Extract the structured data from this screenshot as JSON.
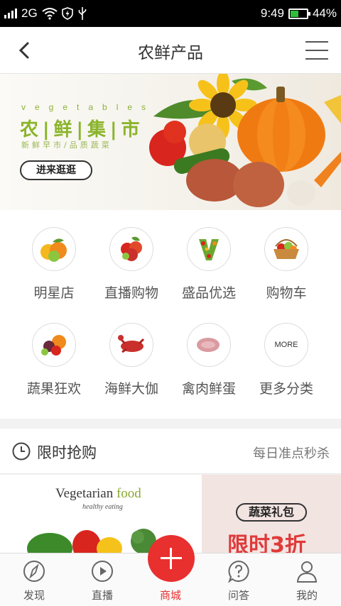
{
  "status_bar": {
    "network": "2G",
    "time": "9:49",
    "battery": "44%",
    "battery_level": 0.44,
    "icons": [
      "signal-icon",
      "wifi-icon",
      "shield-icon",
      "usb-icon",
      "battery-icon"
    ]
  },
  "header": {
    "title": "农鲜产品",
    "back_icon": "chevron-left-icon",
    "menu_icon": "hamburger-menu-icon"
  },
  "banner": {
    "small_text": "vegetables",
    "big_text": "农|鲜|集|市",
    "sub_text": "新鲜早市/品质蔬菜",
    "button": "进来逛逛"
  },
  "categories": [
    {
      "label": "明星店",
      "icon": "fruit-icon"
    },
    {
      "label": "直播购物",
      "icon": "fruit-bowl-icon"
    },
    {
      "label": "盛品优选",
      "icon": "v-logo-icon"
    },
    {
      "label": "购物车",
      "icon": "basket-icon"
    },
    {
      "label": "蔬果狂欢",
      "icon": "vegetables-icon"
    },
    {
      "label": "海鲜大伽",
      "icon": "lobster-icon"
    },
    {
      "label": "禽肉鲜蛋",
      "icon": "meat-icon"
    },
    {
      "label": "更多分类",
      "icon": "more-icon",
      "icon_text": "MORE"
    }
  ],
  "flash_sale": {
    "title": "限时抢购",
    "link": "每日准点秒杀",
    "icon": "clock-icon"
  },
  "promo": {
    "left_title_main": "Vegetarian ",
    "left_title_accent": "food",
    "left_subtitle": "healthy eating",
    "right_tag": "蔬菜礼包",
    "right_big": "限时3折"
  },
  "tabbar": {
    "items": [
      {
        "label": "发现",
        "icon": "compass-icon"
      },
      {
        "label": "直播",
        "icon": "play-icon"
      },
      {
        "label": "商城",
        "icon": "plus-icon",
        "active": true
      },
      {
        "label": "问答",
        "icon": "question-icon"
      },
      {
        "label": "我的",
        "icon": "user-icon"
      }
    ]
  },
  "colors": {
    "accent": "#e8302f",
    "banner_green": "#8ab42a",
    "battery_green": "#2fbf3a"
  }
}
